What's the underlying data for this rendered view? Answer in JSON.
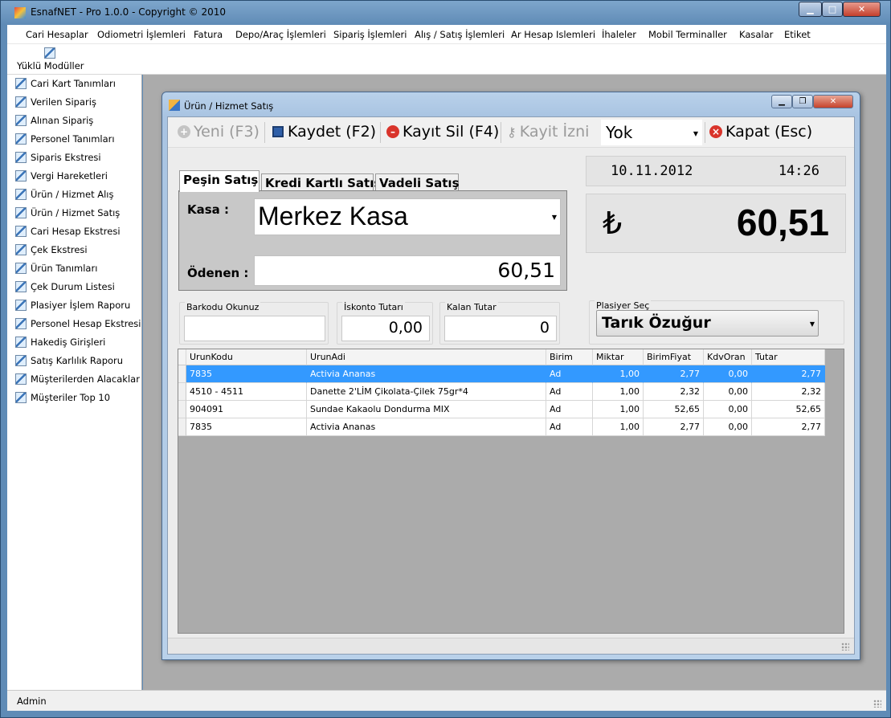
{
  "window": {
    "title": "EsnafNET - Pro 1.0.0 - Copyright ©  2010",
    "controls": [
      "minimize",
      "maximize",
      "close"
    ]
  },
  "menu": [
    "Cari Hesaplar",
    "Odiometri İşlemleri",
    "Fatura",
    "Depo/Araç İşlemleri",
    "Sipariş İşlemleri",
    "Alış / Satış İşlemleri",
    "Ar Hesap Islemleri",
    "İhaleler",
    "Mobil Terminaller",
    "Kasalar",
    "Etiket"
  ],
  "modules": {
    "label": "Yüklü Modüller"
  },
  "sidebar": {
    "items": [
      "Cari Kart Tanımları",
      "Verilen Sipariş",
      "Alınan Sipariş",
      "Personel Tanımları",
      "Siparis Ekstresi",
      "Vergi Hareketleri",
      "Ürün / Hizmet Alış",
      "Ürün / Hizmet Satış",
      "Cari Hesap Ekstresi",
      "Çek Ekstresi",
      "Ürün Tanımları",
      "Çek Durum Listesi",
      "Plasiyer İşlem Raporu",
      "Personel Hesap Ekstresi",
      "Hakediş Girişleri",
      "Satış Karlılık Raporu",
      "Müşterilerden Alacaklar",
      "Müşteriler Top 10"
    ]
  },
  "status": {
    "user": "Admin"
  },
  "child": {
    "title": "Ürün / Hizmet Satış",
    "toolbar": {
      "new": "Yeni (F3)",
      "save": "Kaydet (F2)",
      "delete": "Kayıt Sil (F4)",
      "permission": "Kayit İzni",
      "permission_value": "Yok",
      "close": "Kapat (Esc)"
    },
    "date": "10.11.2012",
    "time": "14:26",
    "currency_symbol": "₺",
    "total": "60,51",
    "tabs": [
      "Peşin Satış",
      "Kredi Kartlı Satış",
      "Vadeli Satış"
    ],
    "active_tab": "Peşin Satış",
    "cash": {
      "kasa_label": "Kasa :",
      "kasa_value": "Merkez Kasa",
      "odenen_label": "Ödenen :",
      "odenen_value": "60,51"
    },
    "fields": {
      "barkod_label": "Barkodu Okunuz",
      "barkod_value": "",
      "iskonto_label": "İskonto Tutarı",
      "iskonto_value": "0,00",
      "kalan_label": "Kalan Tutar",
      "kalan_value": "0",
      "plasiyer_label": "Plasiyer Seç",
      "plasiyer_value": "Tarık Özuğur"
    },
    "grid": {
      "columns": [
        "UrunKodu",
        "UrunAdi",
        "Birim",
        "Miktar",
        "BirimFiyat",
        "KdvOran",
        "Tutar"
      ],
      "rows": [
        [
          "7835",
          "Activia Ananas",
          "Ad",
          "1,00",
          "2,77",
          "0,00",
          "2,77"
        ],
        [
          "4510 - 4511",
          "Danette 2'LİM Çikolata-Çilek 75gr*4",
          "Ad",
          "1,00",
          "2,32",
          "0,00",
          "2,32"
        ],
        [
          "904091",
          "Sundae Kakaolu Dondurma MIX",
          "Ad",
          "1,00",
          "52,65",
          "0,00",
          "52,65"
        ],
        [
          "7835",
          "Activia Ananas",
          "Ad",
          "1,00",
          "2,77",
          "0,00",
          "2,77"
        ]
      ],
      "selected_row": 0
    }
  },
  "colors": {
    "selection": "#3399ff",
    "mdi_background": "#ababab",
    "title_gradient": "#b9d1ea"
  }
}
